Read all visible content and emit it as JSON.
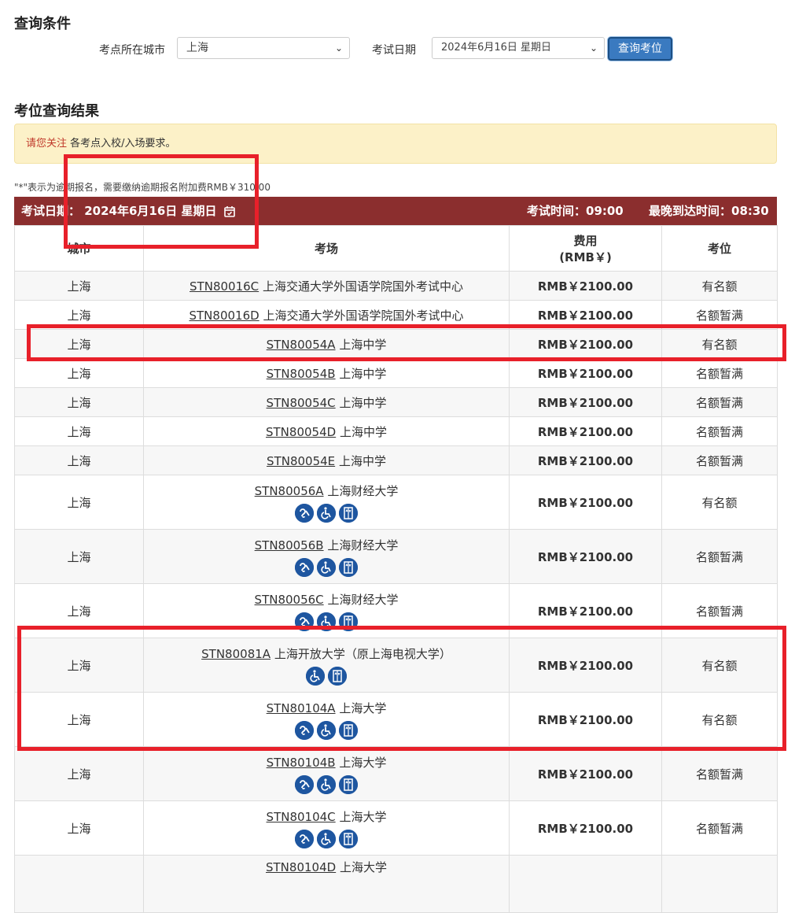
{
  "query": {
    "title": "查询条件",
    "city_label": "考点所在城市",
    "city_value": "上海",
    "date_label": "考试日期",
    "date_value": "2024年6月16日 星期日",
    "search_button": "查询考位"
  },
  "results": {
    "title": "考位查询结果",
    "notice_highlight": "请您关注",
    "notice_text": " 各考点入校/入场要求。",
    "late_note": "\"*\"表示为逾期报名，需要缴纳逾期报名附加费RMB￥310.00",
    "bar": {
      "date_text": "考试日期：  2024年6月16日  星期日",
      "exam_time": "考试时间：09:00",
      "latest_arrival": "最晚到达时间：08:30"
    },
    "headers": {
      "city": "城市",
      "venue": "考场",
      "fee": "费用",
      "fee_unit": "(RMB￥)",
      "seat": "考位"
    },
    "rows": [
      {
        "city": "上海",
        "code": "STN80016C",
        "name": "上海交通大学外国语学院国外考试中心",
        "fee": "RMB￥2100.00",
        "seat": "有名额",
        "icons": []
      },
      {
        "city": "上海",
        "code": "STN80016D",
        "name": "上海交通大学外国语学院国外考试中心",
        "fee": "RMB￥2100.00",
        "seat": "名额暂满",
        "icons": []
      },
      {
        "city": "上海",
        "code": "STN80054A",
        "name": "上海中学",
        "fee": "RMB￥2100.00",
        "seat": "有名额",
        "icons": []
      },
      {
        "city": "上海",
        "code": "STN80054B",
        "name": "上海中学",
        "fee": "RMB￥2100.00",
        "seat": "名额暂满",
        "icons": []
      },
      {
        "city": "上海",
        "code": "STN80054C",
        "name": "上海中学",
        "fee": "RMB￥2100.00",
        "seat": "名额暂满",
        "icons": []
      },
      {
        "city": "上海",
        "code": "STN80054D",
        "name": "上海中学",
        "fee": "RMB￥2100.00",
        "seat": "名额暂满",
        "icons": []
      },
      {
        "city": "上海",
        "code": "STN80054E",
        "name": "上海中学",
        "fee": "RMB￥2100.00",
        "seat": "名额暂满",
        "icons": []
      },
      {
        "city": "上海",
        "code": "STN80056A",
        "name": "上海财经大学",
        "fee": "RMB￥2100.00",
        "seat": "有名额",
        "icons": [
          "ear-icon",
          "wheelchair-icon",
          "elevator-icon"
        ]
      },
      {
        "city": "上海",
        "code": "STN80056B",
        "name": "上海财经大学",
        "fee": "RMB￥2100.00",
        "seat": "名额暂满",
        "icons": [
          "ear-icon",
          "wheelchair-icon",
          "elevator-icon"
        ]
      },
      {
        "city": "上海",
        "code": "STN80056C",
        "name": "上海财经大学",
        "fee": "RMB￥2100.00",
        "seat": "名额暂满",
        "icons": [
          "ear-icon",
          "wheelchair-icon",
          "elevator-icon"
        ]
      },
      {
        "city": "上海",
        "code": "STN80081A",
        "name": "上海开放大学（原上海电视大学）",
        "fee": "RMB￥2100.00",
        "seat": "有名额",
        "icons": [
          "wheelchair-icon",
          "elevator-icon"
        ]
      },
      {
        "city": "上海",
        "code": "STN80104A",
        "name": "上海大学",
        "fee": "RMB￥2100.00",
        "seat": "有名额",
        "icons": [
          "ear-icon",
          "wheelchair-icon",
          "elevator-icon"
        ]
      },
      {
        "city": "上海",
        "code": "STN80104B",
        "name": "上海大学",
        "fee": "RMB￥2100.00",
        "seat": "名额暂满",
        "icons": [
          "ear-icon",
          "wheelchair-icon",
          "elevator-icon"
        ]
      },
      {
        "city": "上海",
        "code": "STN80104C",
        "name": "上海大学",
        "fee": "RMB￥2100.00",
        "seat": "名额暂满",
        "icons": [
          "ear-icon",
          "wheelchair-icon",
          "elevator-icon"
        ]
      },
      {
        "city": "",
        "code": "STN80104D",
        "name": "上海大学",
        "fee": "",
        "seat": "",
        "icons": []
      }
    ]
  },
  "colors": {
    "header_bar": "#8b2e2e",
    "notice_bg": "#fcf1c8",
    "button": "#3a7ac0",
    "icon": "#1e56a0",
    "highlight_box": "#e8202a"
  }
}
